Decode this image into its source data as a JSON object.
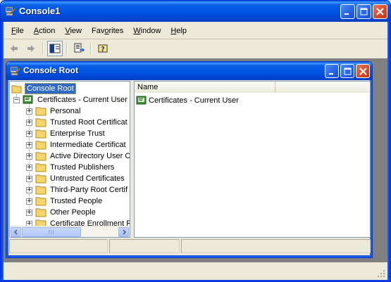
{
  "window": {
    "title": "Console1",
    "icon": "mmc-console-icon"
  },
  "menu": {
    "items": [
      {
        "label": "File",
        "accel": "F"
      },
      {
        "label": "Action",
        "accel": "A"
      },
      {
        "label": "View",
        "accel": "V"
      },
      {
        "label": "Favorites",
        "accel": "o"
      },
      {
        "label": "Window",
        "accel": "W"
      },
      {
        "label": "Help",
        "accel": "H"
      }
    ]
  },
  "toolbar": {
    "buttons": [
      "back-arrow-icon",
      "forward-arrow-icon",
      "show-hide-console-tree-icon",
      "export-list-icon",
      "help-icon"
    ]
  },
  "child": {
    "title": "Console Root",
    "tree": {
      "root": "Console Root",
      "store": "Certificates - Current User",
      "items": [
        "Personal",
        "Trusted Root Certificat",
        "Enterprise Trust",
        "Intermediate Certificat",
        "Active Directory User C",
        "Trusted Publishers",
        "Untrusted Certificates",
        "Third-Party Root Certif",
        "Trusted People",
        "Other People",
        "Certificate Enrollment R"
      ]
    },
    "list": {
      "columns": [
        "Name"
      ],
      "rows": [
        "Certificates - Current User"
      ]
    }
  },
  "colors": {
    "titlebar": "#0054e3",
    "selection": "#316ac5",
    "mdi_background": "#808080"
  }
}
